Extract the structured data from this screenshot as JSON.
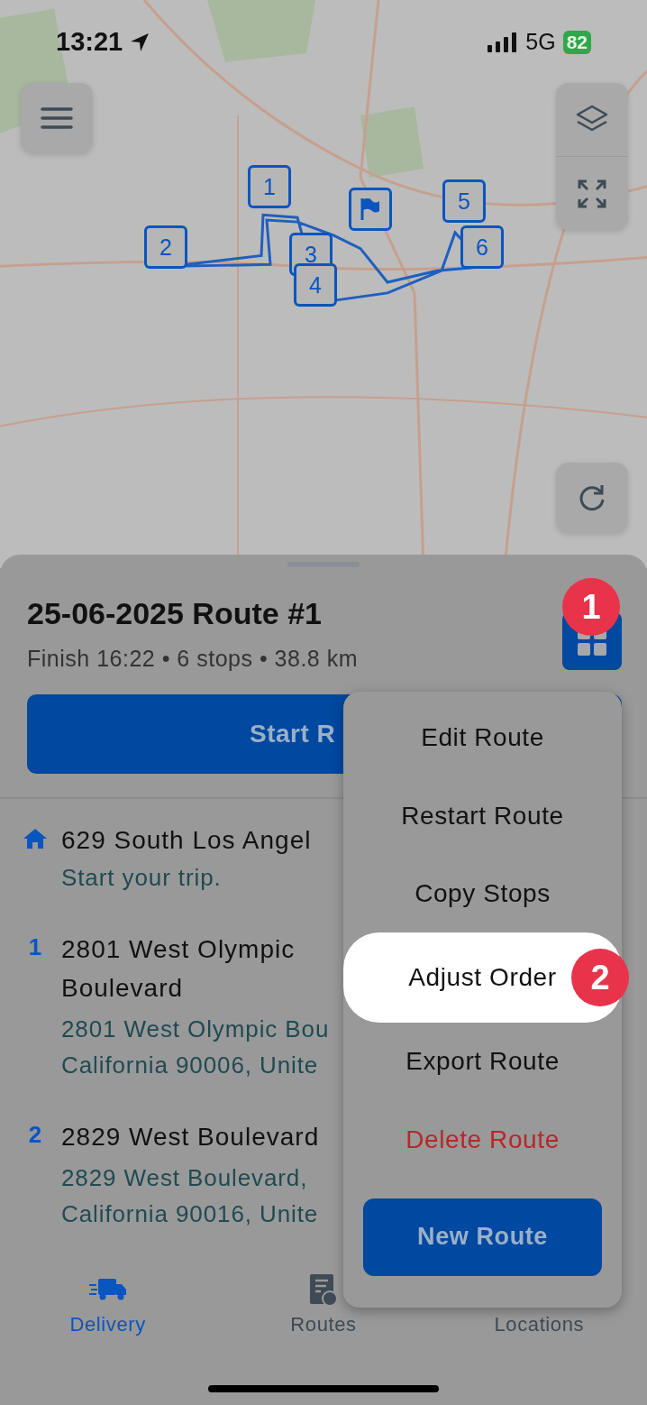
{
  "status_bar": {
    "time": "13:21",
    "network": "5G",
    "battery": "82"
  },
  "map": {
    "kind": "picture",
    "pins": [
      {
        "kind": "number",
        "label": "1"
      },
      {
        "kind": "number",
        "label": "2"
      },
      {
        "kind": "number",
        "label": "3"
      },
      {
        "kind": "number",
        "label": "4"
      },
      {
        "kind": "flag"
      },
      {
        "kind": "number",
        "label": "5"
      },
      {
        "kind": "number",
        "label": "6"
      }
    ]
  },
  "route": {
    "title": "25-06-2025 Route #1",
    "summary": "Finish 16:22 • 6 stops • 38.8 km",
    "start_button": "Start R",
    "menu_step": "1"
  },
  "stops": [
    {
      "kind": "home",
      "name": "629 South Los Angel",
      "note": "Start your trip."
    },
    {
      "kind": "stop",
      "number": "1",
      "name": "2801 West Olympic Boulevard",
      "address_lines": [
        "2801 West Olympic Bou",
        "California 90006, Unite"
      ]
    },
    {
      "kind": "stop",
      "number": "2",
      "name": "2829 West Boulevard",
      "address_lines": [
        "2829 West Boulevard,",
        "California 90016, Unite"
      ]
    }
  ],
  "menu": {
    "items": [
      {
        "label": "Edit Route",
        "kind": "normal",
        "highlighted": false
      },
      {
        "label": "Restart Route",
        "kind": "normal",
        "highlighted": false
      },
      {
        "label": "Copy Stops",
        "kind": "normal",
        "highlighted": false
      },
      {
        "label": "Adjust Order",
        "kind": "normal",
        "highlighted": true,
        "step": "2"
      },
      {
        "label": "Export Route",
        "kind": "normal",
        "highlighted": false
      },
      {
        "label": "Delete Route",
        "kind": "danger",
        "highlighted": false
      }
    ],
    "button": "New Route"
  },
  "tabs": [
    {
      "label": "Delivery",
      "selected": true
    },
    {
      "label": "Routes",
      "selected": false
    },
    {
      "label": "Locations",
      "selected": false
    }
  ]
}
